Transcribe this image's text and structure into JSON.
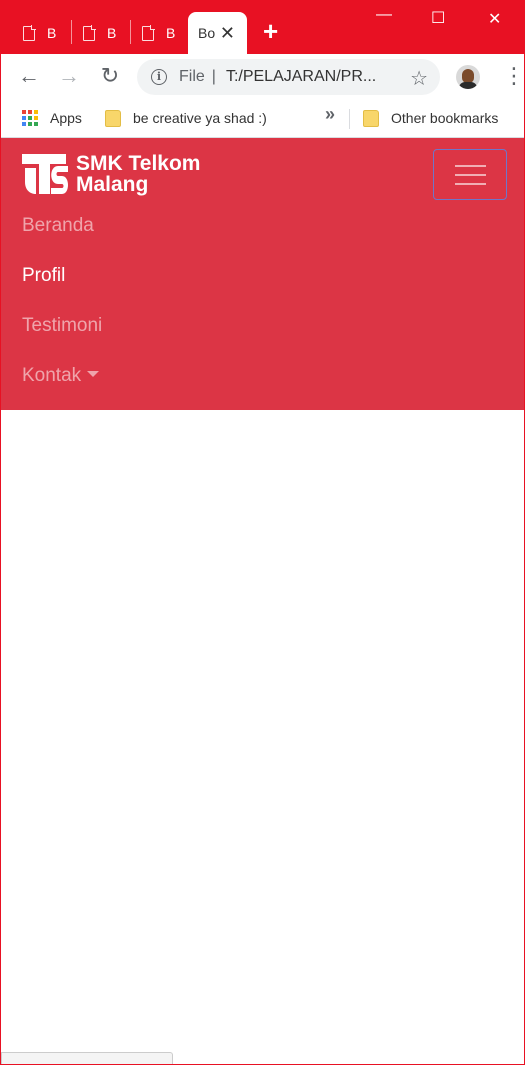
{
  "browser": {
    "tabs": [
      {
        "title": "B"
      },
      {
        "title": "B"
      },
      {
        "title": "B"
      }
    ],
    "active_tab": {
      "title": "Bo",
      "close": "✕"
    },
    "new_tab": "+",
    "window_controls": {
      "minimize": "—",
      "maximize": "☐",
      "close": "✕"
    },
    "nav": {
      "back": "←",
      "forward": "→",
      "reload": "↻"
    },
    "address": {
      "scheme": "File",
      "separator": "|",
      "url": "T:/PELAJARAN/PR..."
    },
    "bookmarks": {
      "apps": "Apps",
      "items": [
        "be creative ya shad :)"
      ],
      "more": "»",
      "other": "Other bookmarks"
    },
    "accent_color": "#e81123"
  },
  "site": {
    "brand": {
      "line1": "SMK Telkom",
      "line2": "Malang"
    },
    "nav_items": [
      {
        "label": "Beranda",
        "active": false
      },
      {
        "label": "Profil",
        "active": true
      },
      {
        "label": "Testimoni",
        "active": false
      },
      {
        "label": "Kontak",
        "active": false,
        "dropdown": true
      }
    ],
    "navbar_color": "#dc3545"
  }
}
